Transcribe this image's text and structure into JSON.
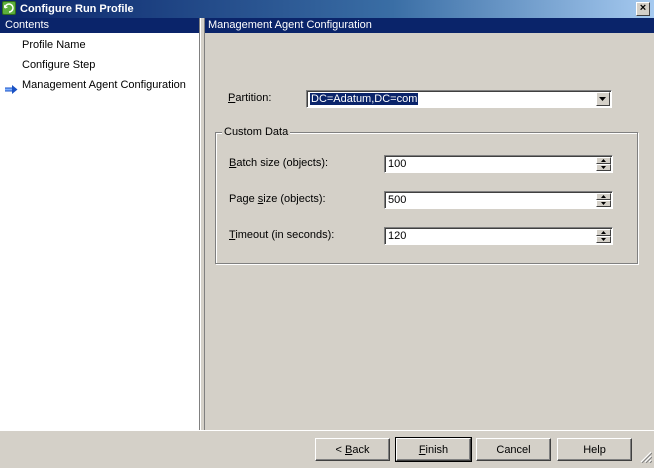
{
  "window": {
    "title": "Configure Run Profile",
    "close_glyph": "×"
  },
  "contents": {
    "header": "Contents",
    "items": [
      {
        "label": "Profile Name",
        "selected": false
      },
      {
        "label": "Configure Step",
        "selected": false
      },
      {
        "label": "Management Agent Configuration",
        "selected": true
      }
    ]
  },
  "main": {
    "header": "Management Agent Configuration",
    "partition": {
      "label_pre": "",
      "label_mnemonic": "P",
      "label_post": "artition:",
      "value": "DC=Adatum,DC=com"
    },
    "custom_data": {
      "title": "Custom Data",
      "fields": [
        {
          "label_pre": "",
          "label_mnemonic": "B",
          "label_post": "atch size (objects):",
          "value": "100"
        },
        {
          "label_pre": "Page ",
          "label_mnemonic": "s",
          "label_post": "ize (objects):",
          "value": "500"
        },
        {
          "label_pre": "",
          "label_mnemonic": "T",
          "label_post": "imeout (in seconds):",
          "value": "120"
        }
      ]
    }
  },
  "buttons": {
    "back_prefix": "< ",
    "back_mnemonic": "B",
    "back_rest": "ack",
    "finish_mnemonic": "F",
    "finish_rest": "inish",
    "cancel": "Cancel",
    "help": "Help"
  },
  "colors": {
    "selection": "#0a246a",
    "face": "#d4d0c8",
    "nav_arrow": "#1a52c4"
  }
}
